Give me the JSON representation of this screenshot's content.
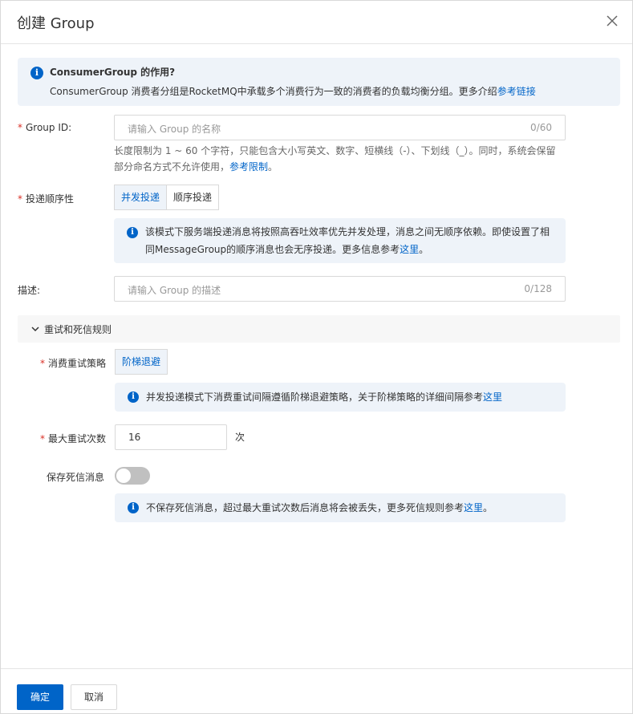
{
  "dialog": {
    "title": "创建 Group"
  },
  "intro": {
    "title": "ConsumerGroup 的作用?",
    "body": "ConsumerGroup 消费者分组是RocketMQ中承载多个消费行为一致的消费者的负载均衡分组。更多介绍",
    "link": "参考链接"
  },
  "group_id": {
    "label": "Group ID:",
    "placeholder": "请输入 Group 的名称",
    "counter": "0/60",
    "help_line1": "长度限制为 1 ~ 60 个字符，只能包含大小写英文、数字、短横线（-）、下划线（_）。同时，系统会保留",
    "help_line2": "部分命名方式不允许使用，",
    "help_link": "参考限制",
    "help_end": "。"
  },
  "delivery": {
    "label": "投递顺序性",
    "options": [
      "并发投递",
      "顺序投递"
    ],
    "selected": "并发投递",
    "info_line1": "该模式下服务端投递消息将按照高吞吐效率优先并发处理，消息之间无顺序依赖。即使设置了相",
    "info_line2": "同MessageGroup的顺序消息也会无序投递。更多信息参考",
    "info_link": "这里",
    "info_end": "。"
  },
  "description": {
    "label": "描述:",
    "placeholder": "请输入 Group 的描述",
    "counter": "0/128"
  },
  "retry_section": {
    "title": "重试和死信规则",
    "strategy_label": "消费重试策略",
    "strategy_option": "阶梯退避",
    "strategy_info": "并发投递模式下消费重试间隔遵循阶梯退避策略，关于阶梯策略的详细间隔参考",
    "strategy_link": "这里",
    "max_retry_label": "最大重试次数",
    "max_retry_value": "16",
    "max_retry_unit": "次",
    "dead_letter_label": "保存死信消息",
    "dead_letter_enabled": false,
    "dead_letter_info": "不保存死信消息，超过最大重试次数后消息将会被丢失，更多死信规则参考",
    "dead_letter_link": "这里",
    "dead_letter_end": "。"
  },
  "footer": {
    "confirm": "确定",
    "cancel": "取消"
  },
  "colors": {
    "primary": "#0064c8",
    "info_bg": "#eef3f9",
    "required": "#d93026"
  }
}
